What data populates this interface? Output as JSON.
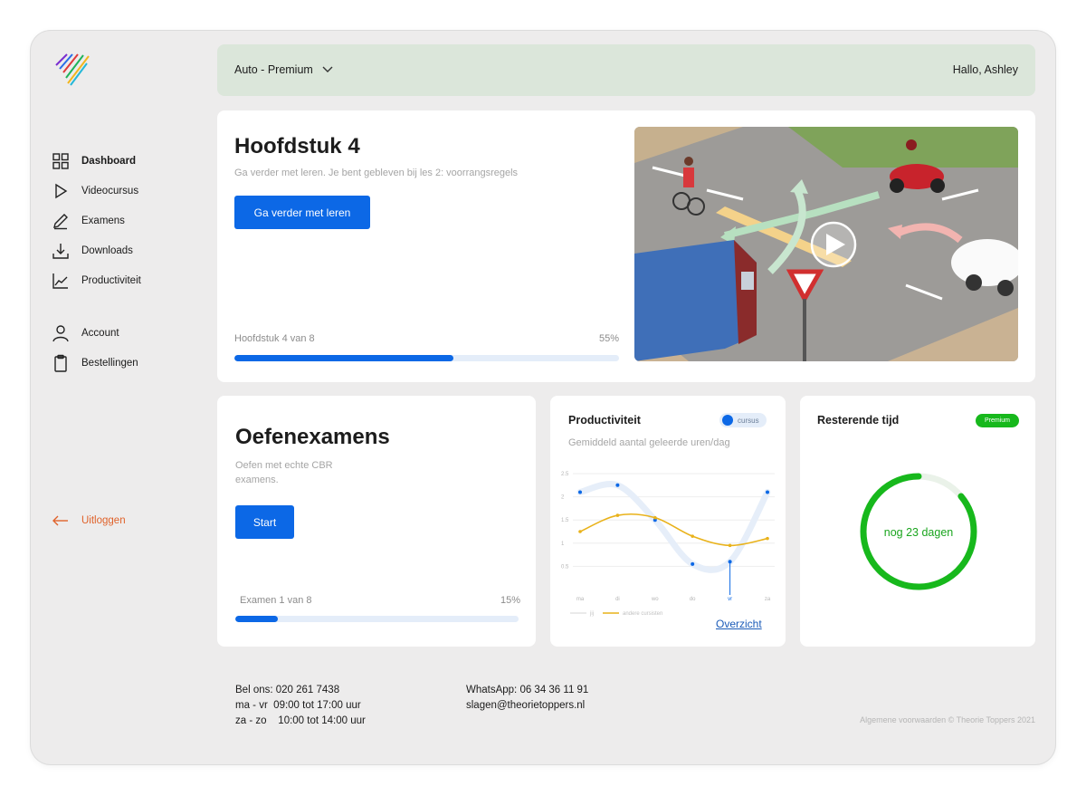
{
  "topbar": {
    "plan": "Auto - Premium",
    "greeting": "Hallo, Ashley"
  },
  "sidebar": {
    "items": [
      {
        "label": "Dashboard",
        "icon": "grid-icon"
      },
      {
        "label": "Videocursus",
        "icon": "play-icon"
      },
      {
        "label": "Examens",
        "icon": "pencil-icon"
      },
      {
        "label": "Downloads",
        "icon": "download-icon"
      },
      {
        "label": "Productiviteit",
        "icon": "chart-icon"
      }
    ],
    "account_items": [
      {
        "label": "Account",
        "icon": "user-icon"
      },
      {
        "label": "Bestellingen",
        "icon": "clipboard-icon"
      }
    ],
    "logout": "Uitloggen"
  },
  "hero": {
    "title": "Hoofdstuk 4",
    "subtitle": "Ga verder met leren. Je bent gebleven bij les 2: voorrangsregels",
    "button": "Ga verder met leren",
    "progress_label": "Hoofdstuk 4 van 8",
    "progress_text": "55%",
    "progress": 0.57
  },
  "exam": {
    "title": "Oefenexamens",
    "subtitle": "Oefen met echte CBR examens.",
    "button": "Start",
    "progress_label": "Examen 1 van 8",
    "progress_text": "15%",
    "progress": 0.15
  },
  "productivity": {
    "title": "Productiviteit",
    "toggle_label": "cursus",
    "subtitle": "Gemiddeld aantal geleerde uren/dag",
    "link": "Overzicht",
    "legend": [
      "jij",
      "andere cursisten"
    ]
  },
  "chart_data": {
    "type": "line",
    "categories": [
      "ma",
      "di",
      "wo",
      "do",
      "vr",
      "za"
    ],
    "yticks": [
      "2.5",
      "2",
      "1.5",
      "1",
      "0.5"
    ],
    "ylim": [
      0,
      2.5
    ],
    "highlight": "vr",
    "series": [
      {
        "name": "jij",
        "values": [
          2.1,
          2.25,
          1.5,
          0.55,
          0.6,
          2.1
        ]
      },
      {
        "name": "andere cursisten",
        "values": [
          1.25,
          1.6,
          1.55,
          1.15,
          0.95,
          1.1
        ]
      }
    ],
    "colors": {
      "jij": "#e6eef9",
      "andere cursisten": "#e9b21a",
      "points": "#0c68e6"
    }
  },
  "remaining": {
    "title": "Resterende tijd",
    "badge": "Premium",
    "label": "nog 23 dagen",
    "fraction": 0.86
  },
  "footer": {
    "phone": "Bel ons: 020 261 7438",
    "hours_week_days": "ma - vr",
    "hours_week": "09:00 tot 17:00 uur",
    "hours_weekend_days": "za - zo",
    "hours_weekend": "10:00 tot 14:00 uur",
    "whatsapp": "WhatsApp: 06 34 36 11 91",
    "email": "slagen@theorietoppers.nl",
    "copyright": "Algemene voorwaarden © Theorie Toppers 2021"
  },
  "colors": {
    "accent": "#0c68e6",
    "green": "#17b81c",
    "logout": "#e0622a",
    "topbar": "#dbe6da"
  }
}
